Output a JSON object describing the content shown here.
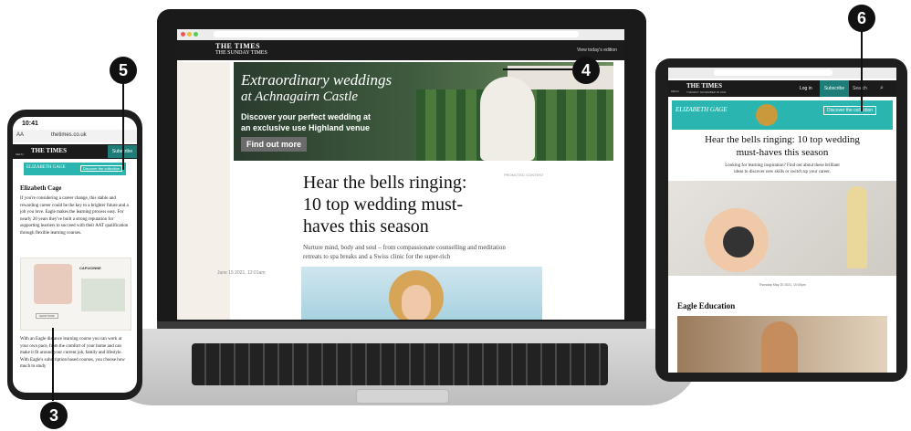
{
  "laptop": {
    "masthead_line1": "THE TIMES",
    "masthead_line2": "THE SUNDAY TIMES",
    "view_edition": "View today's edition",
    "ad": {
      "headline_1": "Extraordinary weddings",
      "headline_2": "at Achnagairn Castle",
      "subtext_1": "Discover your perfect wedding at",
      "subtext_2": "an exclusive use Highland venue",
      "cta": "Find out more"
    },
    "article": {
      "title_1": "Hear the bells ringing:",
      "title_2": "10 top wedding must-",
      "title_3": "haves this season",
      "standfirst_1": "Nurture mind, body and soul – from compassionate counselling and meditation",
      "standfirst_2": "retreats to spa breaks and a Swiss clinic for the super-rich",
      "promoted": "PROMOTED CONTENT",
      "date": "June 15 2021, 12:01am"
    }
  },
  "phone": {
    "time": "10:41",
    "url": "thetimes.co.uk",
    "aa": "AA",
    "masthead": "THE TIMES",
    "subscribe": "Subscribe",
    "menu": "MENU",
    "ad_brand": "ELIZABETH GAGE",
    "ad_cta": "Discover the collection",
    "article_heading": "Elizabeth Cage",
    "para_1": "If you're considering a career change, this stable and rewarding career could be the key to a brighter future and a job you love. Eagle makes the learning process easy. For nearly 20 years they've built a strong reputation for supporting learners to succeed with their AAT qualification through flexible learning courses.",
    "ad2_brand": "CAPUCINNE",
    "ad2_cta": "SHOP NOW",
    "para_2": "With an Eagle distance learning course you can work at your own pace, from the comfort of your home and can make it fit around your current job, family and lifestyle. With Eagle's subscription based courses, you choose how much to study"
  },
  "tablet": {
    "masthead": "THE TIMES",
    "masthead_sub": "TUESDAY NOVEMBER 30 2021",
    "menu": "MENU",
    "login": "Log in",
    "subscribe": "Subscribe",
    "search": "Search",
    "ad_brand": "ELIZABETH GAGE",
    "ad_cta": "Discover the collection",
    "title_1": "Hear the bells ringing: 10 top wedding",
    "title_2": "must-haves this season",
    "standfirst_1": "Looking for learning inspiration? Find out about these brilliant",
    "standfirst_2": "ideas to discover new skills or switch up your career.",
    "date": "Thursday May 20 2021, 10:00pm",
    "section_heading": "Eagle Education"
  },
  "markers": {
    "m3": "3",
    "m4": "4",
    "m5": "5",
    "m6": "6"
  },
  "colors": {
    "ad_teal": "#2bb5b0",
    "subscribe_teal": "#1e7d78",
    "marker": "#111111"
  }
}
